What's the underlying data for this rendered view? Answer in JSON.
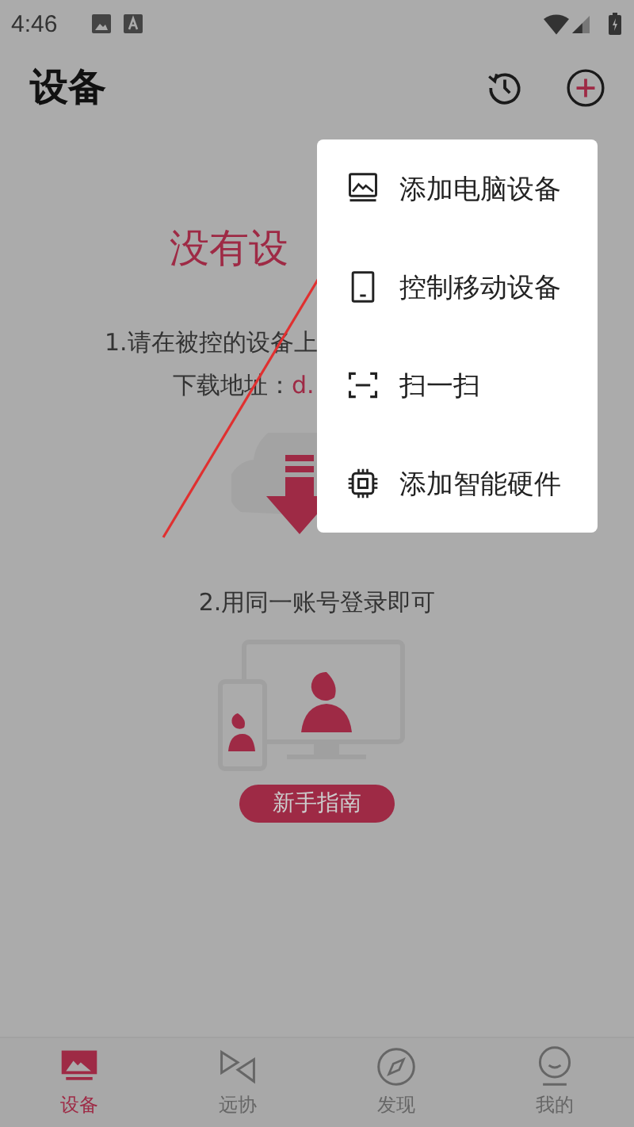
{
  "status_bar": {
    "time": "4:46"
  },
  "header": {
    "title": "设备"
  },
  "empty_state": {
    "title": "没有设",
    "step_1": "1.请在被控的设备上",
    "download_label": "下载地址：",
    "download_link": "d.",
    "step_2": "2.用同一账号登录即可",
    "guide_button": "新手指南"
  },
  "menu": {
    "items": [
      {
        "label": "添加电脑设备",
        "kind": "computer"
      },
      {
        "label": "控制移动设备",
        "kind": "mobile"
      },
      {
        "label": "扫一扫",
        "kind": "scan"
      },
      {
        "label": "添加智能硬件",
        "kind": "chip"
      }
    ]
  },
  "bottom_nav": [
    {
      "label": "设备",
      "kind": "device",
      "selected": true
    },
    {
      "label": "远协",
      "kind": "remote",
      "selected": false
    },
    {
      "label": "发现",
      "kind": "discover",
      "selected": false
    },
    {
      "label": "我的",
      "kind": "me",
      "selected": false
    }
  ]
}
